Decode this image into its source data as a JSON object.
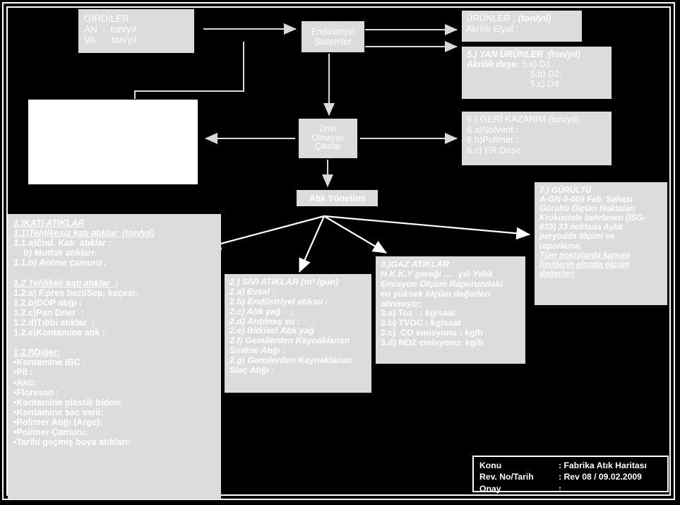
{
  "diagram": {
    "title_block": {
      "rows": [
        {
          "key": "Konu",
          "value": ": Fabrika Atık Haritası"
        },
        {
          "key": "Rev. No/Tarih",
          "value": ": Rev 08 / 09.02.2009"
        },
        {
          "key": "Onay",
          "value": ":"
        }
      ]
    },
    "inputs": {
      "heading": "GİRDİLER",
      "lines": [
        "AN  :  ton/yıl",
        "VA  :   ton/yıl"
      ]
    },
    "process": {
      "industrial_systems": [
        "Endüstriyel",
        "Sistemler"
      ],
      "non_product_outputs": [
        "Ürün",
        "Olmayan",
        "Çıktılar"
      ],
      "waste_management": "Atık Yönetimi"
    },
    "products": {
      "heading": "ÜRÜNLER ;",
      "heading_unit": "(ton/yıl)",
      "lines": [
        "Akrilik Elyaf :"
      ]
    },
    "byproducts": {
      "heading": "5.) YAN ÜRÜNLER ;(ton/yıl)",
      "label": "Akrilik deşe:",
      "items": [
        "5.a) D1",
        "5.b) D2:",
        "5.c) D4:"
      ]
    },
    "recovery": {
      "heading": "6.) GERİ KAZANIM (ton/yıl)",
      "lines": [
        "6.a)Solvent :",
        "6.b)Polimer :",
        "6.c) FR Deşe:"
      ]
    },
    "noise": {
      "heading": "7.) GÜRÜLTÜ",
      "body": "A-GN-0-009 Fab. Sahası\nGürültü Ölçüm Noktaları\nKrokisinde belirlenen (İSG-\n033) 33 noktada Aylık\nperyodda ölçüm ve\nraporlama,",
      "underlined": "Tüm noktalarda kanuni\nlimitlerin altında ölçüm\ndeğerleri"
    },
    "solid_waste": {
      "heading": "1.)KATI ATIKLAR",
      "subheading": "1.1)Tehlikesiz katı atıklar  (ton/yıl)",
      "group1": [
        "1.1.a)End. Katı  atıklar :",
        "    b) Mutfak atıkları:",
        "1.1.b) Arıtma çamuru :"
      ],
      "hazardous_heading": "1.2 Tehlikeli katı atıklar  ;",
      "group2": [
        "1.2.a) F.pres bezi/Sep. keçesi:",
        "1.2.b)DOP atığı :",
        "1.2.c)Pan Drier  :",
        "1.2.d)Tıbbi atıklar  :",
        "1.2.e)Kontamine atık :"
      ],
      "other_heading": "1.2.f)Diğer:",
      "other_items": [
        "•Kontamine IBC :",
        "•Pil :",
        "•Akü:",
        "•Floresan :",
        "•Kontamine plastik bidon:",
        "•Kontamine sac varil:",
        "•Polimer Atığı (Arge):",
        "•Polimer Çamuru:",
        "•Tarihi geçmiş boya atıkları:"
      ]
    },
    "liquid_waste": {
      "heading": "2.) SIVI ATIKLAR (m³ /gün)",
      "lines": [
        "2.a) Evsel :",
        "2.b) Endüstriyel atıksu :",
        "2.c) Atık yağ    :",
        "2.d) Arıtılmış su :",
        "2.e) Bitkisel Atık yağ",
        "2.f) Gemilerden Kaynaklanan",
        "Sintine Atığı :",
        "2.g) Gemilerden Kaynaklanan",
        "Slaç Atığı :"
      ]
    },
    "gas_waste": {
      "heading": "3.)GAZ ATIKLAR",
      "note": "H.K.K.Y gereği ....  yılı Yıllık\nEmisyon Ölçüm Raporundaki\nen yüksek ölçüm değerleri\nalınmıştır;",
      "lines": [
        "3.a) Toz   : kg/saat",
        "3.b) TVOC : kg/saat",
        "3.c)  CO emisyonu : kg/h",
        "3.d) NO2 emisyonu: kg/h"
      ]
    },
    "colors": {
      "background": "#000000",
      "box_fill": "#dcdcdc",
      "text": "#ffffff",
      "white_box": "#ffffff"
    }
  }
}
